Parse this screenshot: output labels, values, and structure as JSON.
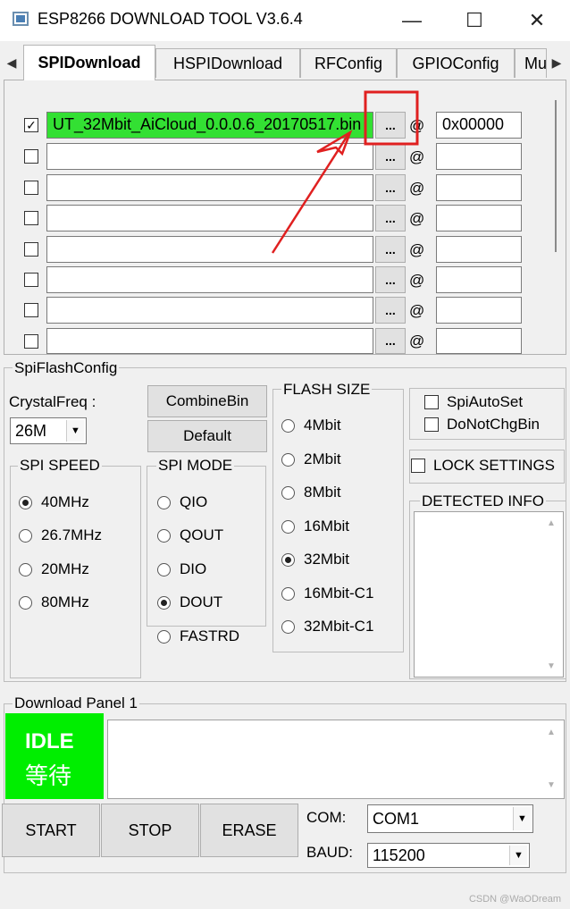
{
  "window": {
    "title": "ESP8266 DOWNLOAD TOOL V3.6.4",
    "minimize": "—",
    "maximize": "☐",
    "close": "✕"
  },
  "tabs": [
    {
      "label": "SPIDownload",
      "active": true
    },
    {
      "label": "HSPIDownload"
    },
    {
      "label": "RFConfig"
    },
    {
      "label": "GPIOConfig"
    },
    {
      "label": "Mu"
    }
  ],
  "tab_scroll": {
    "left": "◀",
    "right": "▶"
  },
  "files": [
    {
      "checked": true,
      "path": "UT_32Mbit_AiCloud_0.0.0.6_20170517.bin",
      "browse": "...",
      "at": "@",
      "addr": "0x00000"
    },
    {
      "checked": false,
      "path": "",
      "browse": "...",
      "at": "@",
      "addr": ""
    },
    {
      "checked": false,
      "path": "",
      "browse": "...",
      "at": "@",
      "addr": ""
    },
    {
      "checked": false,
      "path": "",
      "browse": "...",
      "at": "@",
      "addr": ""
    },
    {
      "checked": false,
      "path": "",
      "browse": "...",
      "at": "@",
      "addr": ""
    },
    {
      "checked": false,
      "path": "",
      "browse": "...",
      "at": "@",
      "addr": ""
    },
    {
      "checked": false,
      "path": "",
      "browse": "...",
      "at": "@",
      "addr": ""
    },
    {
      "checked": false,
      "path": "",
      "browse": "...",
      "at": "@",
      "addr": ""
    }
  ],
  "check_mark": "✓",
  "spiflash": {
    "label": "SpiFlashConfig",
    "crystal_label": "CrystalFreq :",
    "crystal_value": "26M",
    "combine_bin": "CombineBin",
    "default": "Default",
    "spi_speed": {
      "label": "SPI SPEED",
      "options": [
        "40MHz",
        "26.7MHz",
        "20MHz",
        "80MHz"
      ],
      "selected": 0
    },
    "spi_mode": {
      "label": "SPI MODE",
      "options": [
        "QIO",
        "QOUT",
        "DIO",
        "DOUT",
        "FASTRD"
      ],
      "selected": 3
    },
    "flash_size": {
      "label": "FLASH SIZE",
      "options": [
        "4Mbit",
        "2Mbit",
        "8Mbit",
        "16Mbit",
        "32Mbit",
        "16Mbit-C1",
        "32Mbit-C1"
      ],
      "selected": 4
    },
    "spi_auto_set": "SpiAutoSet",
    "do_not_chg_bin": "DoNotChgBin",
    "lock_settings": "LOCK SETTINGS",
    "detected_info": "DETECTED INFO"
  },
  "download_panel": {
    "label": "Download Panel 1",
    "status_en": "IDLE",
    "status_cn": "等待",
    "start": "START",
    "stop": "STOP",
    "erase": "ERASE",
    "com_label": "COM:",
    "com_value": "COM1",
    "baud_label": "BAUD:",
    "baud_value": "115200"
  },
  "scroll_up": "▲",
  "scroll_down": "▼",
  "dropdown_arrow": "▼",
  "watermark": "CSDN @WaODream",
  "colors": {
    "file_filled_bg": "#33e033",
    "idle_bg": "#00ee00",
    "annotation_red": "#e02020"
  }
}
